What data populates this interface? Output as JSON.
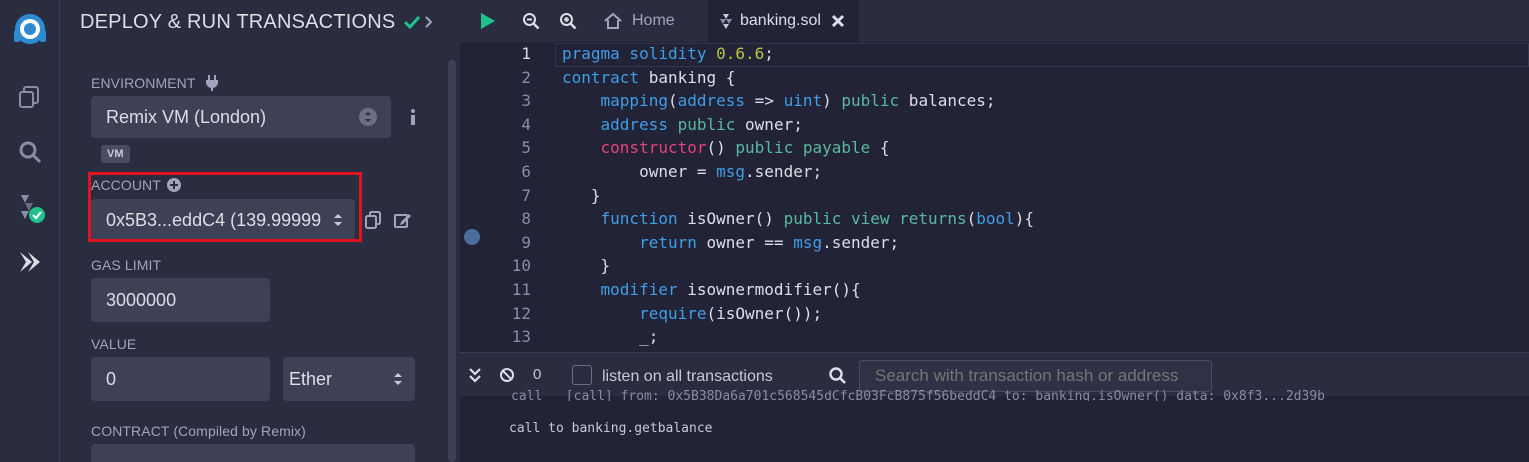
{
  "rail": {
    "icons": [
      "remix-logo-icon",
      "file-explorer-icon",
      "search-icon",
      "solidity-compiler-icon",
      "deploy-run-icon"
    ]
  },
  "panel": {
    "title": "DEPLOY & RUN TRANSACTIONS",
    "environment": {
      "label": "ENVIRONMENT",
      "value": "Remix VM (London)",
      "badge": "VM"
    },
    "account": {
      "label": "ACCOUNT",
      "value": "0x5B3...eddC4 (139.999999"
    },
    "gas_limit": {
      "label": "GAS LIMIT",
      "value": "3000000"
    },
    "value": {
      "label": "VALUE",
      "amount": "0",
      "unit": "Ether"
    },
    "contract": {
      "label": "CONTRACT",
      "note": "(Compiled by Remix)"
    }
  },
  "editor": {
    "tabs": [
      {
        "label": "Home"
      },
      {
        "label": "banking.sol"
      }
    ],
    "line_numbers": [
      "1",
      "2",
      "3",
      "4",
      "5",
      "6",
      "7",
      "8",
      "9",
      "10",
      "11",
      "12",
      "13"
    ],
    "lines": [
      [
        [
          "k",
          "pragma solidity "
        ],
        [
          "n",
          "0.6.6"
        ],
        [
          "t",
          ";"
        ]
      ],
      [
        [
          "k",
          "contract "
        ],
        [
          "t",
          "banking {"
        ]
      ],
      [
        [
          "t",
          "    "
        ],
        [
          "k",
          "mapping"
        ],
        [
          "t",
          "("
        ],
        [
          "k",
          "address"
        ],
        [
          "t",
          " => "
        ],
        [
          "k",
          "uint"
        ],
        [
          "t",
          ") "
        ],
        [
          "g",
          "public"
        ],
        [
          "t",
          " balances;"
        ]
      ],
      [
        [
          "t",
          "    "
        ],
        [
          "k",
          "address"
        ],
        [
          "t",
          " "
        ],
        [
          "g",
          "public"
        ],
        [
          "t",
          " owner;"
        ]
      ],
      [
        [
          "t",
          "    "
        ],
        [
          "p",
          "constructor"
        ],
        [
          "t",
          "() "
        ],
        [
          "g",
          "public payable"
        ],
        [
          "t",
          " {"
        ]
      ],
      [
        [
          "t",
          "        owner = "
        ],
        [
          "k",
          "msg"
        ],
        [
          "t",
          ".sender;"
        ]
      ],
      [
        [
          "t",
          "   }"
        ]
      ],
      [
        [
          "t",
          "    "
        ],
        [
          "k",
          "function"
        ],
        [
          "t",
          " isOwner() "
        ],
        [
          "g",
          "public view returns"
        ],
        [
          "t",
          "("
        ],
        [
          "k",
          "bool"
        ],
        [
          "t",
          "){"
        ]
      ],
      [
        [
          "t",
          "        "
        ],
        [
          "k",
          "return"
        ],
        [
          "t",
          " owner == "
        ],
        [
          "k",
          "msg"
        ],
        [
          "t",
          ".sender;"
        ]
      ],
      [
        [
          "t",
          "    }"
        ]
      ],
      [
        [
          "t",
          "    "
        ],
        [
          "k",
          "modifier"
        ],
        [
          "t",
          " isownermodifier(){"
        ]
      ],
      [
        [
          "t",
          "        "
        ],
        [
          "k",
          "require"
        ],
        [
          "t",
          "(isOwner());"
        ]
      ],
      [
        [
          "t",
          "        _;"
        ]
      ]
    ]
  },
  "terminal": {
    "count": "0",
    "listen_label": "listen on all transactions",
    "search_placeholder": "Search with transaction hash or address",
    "log_partial": "call   [call] from: 0x5B38Da6a701c568545dCfcB03FcB875f56beddC4 to: banking.isOwner() data: 0x8f3...2d39b",
    "log_call": "call to banking.getbalance"
  },
  "colors": {
    "accent": "#3f9ee6",
    "success": "#1ec28b",
    "highlight": "#e0141e"
  }
}
